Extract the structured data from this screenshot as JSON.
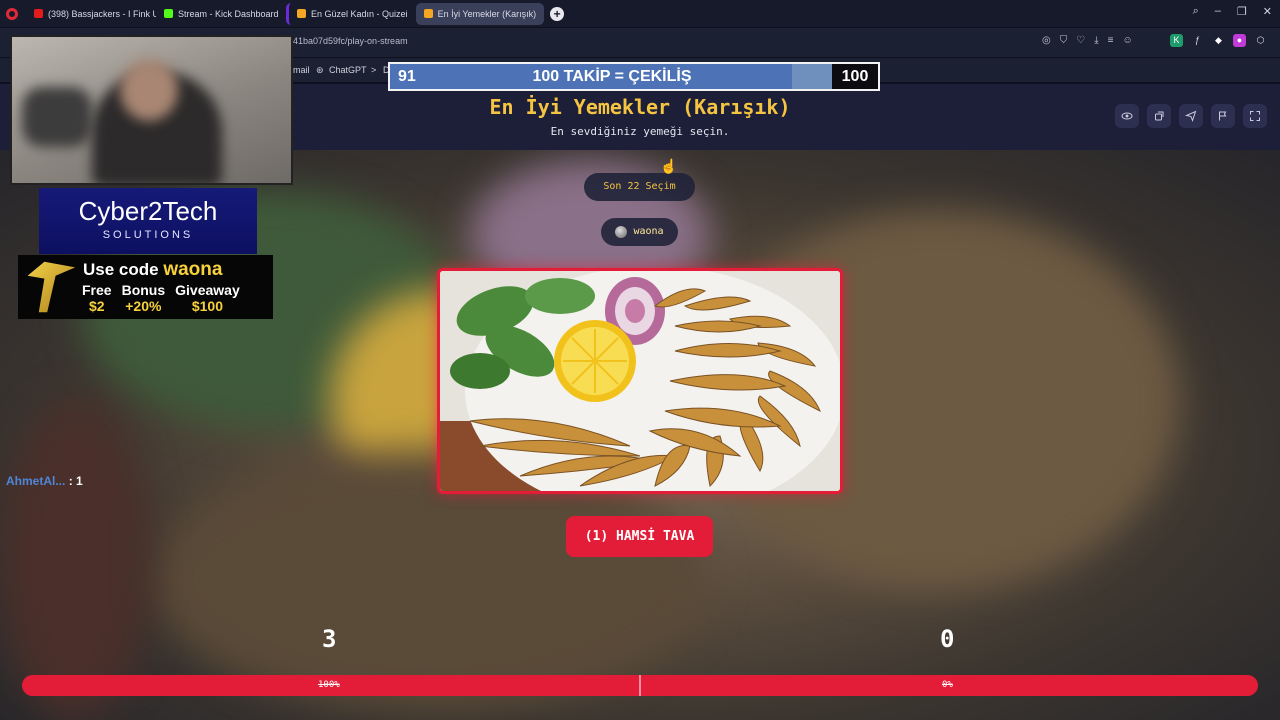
{
  "browser": {
    "tabs": [
      {
        "label": "(398) Bassjackers - I Fink U",
        "fav": "#e21b1b"
      },
      {
        "label": "Stream - Kick Dashboard",
        "fav": "#53fc18"
      },
      {
        "label": "En Güzel Kadın - Quizei",
        "fav": "#f5a623"
      },
      {
        "label": "En İyi Yemekler (Karışık)",
        "fav": "#f5a623"
      }
    ],
    "url": "41ba07d59fc/play-on-stream",
    "bookmarks": {
      "mail": "mail",
      "chatgpt": "ChatGPT",
      "d": "D"
    }
  },
  "page": {
    "title": "En İyi Yemekler (Karışık)",
    "subtitle": "En sevdiğiniz yemeği seçin."
  },
  "quiz": {
    "round": "Son 22 Seçim",
    "user": "waona",
    "choice_label": "(1) HAMSİ TAVA",
    "left_score": "3",
    "right_score": "0",
    "left_percent": "100%",
    "right_percent": "0%",
    "left_share": 1.0
  },
  "overlay": {
    "goal_current": "91",
    "goal_label": "100 TAKİP = ÇEKİLİŞ",
    "goal_max": "100",
    "goal_progress": 0.91,
    "sponsor_title": "Cyber2Tech",
    "sponsor_sub": "SOLUTIONS",
    "promo_use": "Use code",
    "promo_code": "waona",
    "promo_free_a": "Free",
    "promo_free_b": "$2",
    "promo_bonus_a": "Bonus",
    "promo_bonus_b": "+20%",
    "promo_give_a": "Giveaway",
    "promo_give_b": "$100",
    "chat_name": "AhmetAl...",
    "chat_value": ": 1"
  },
  "colors": {
    "accent": "#e31c38",
    "title": "#f5c542",
    "header": "#1d1f38"
  }
}
